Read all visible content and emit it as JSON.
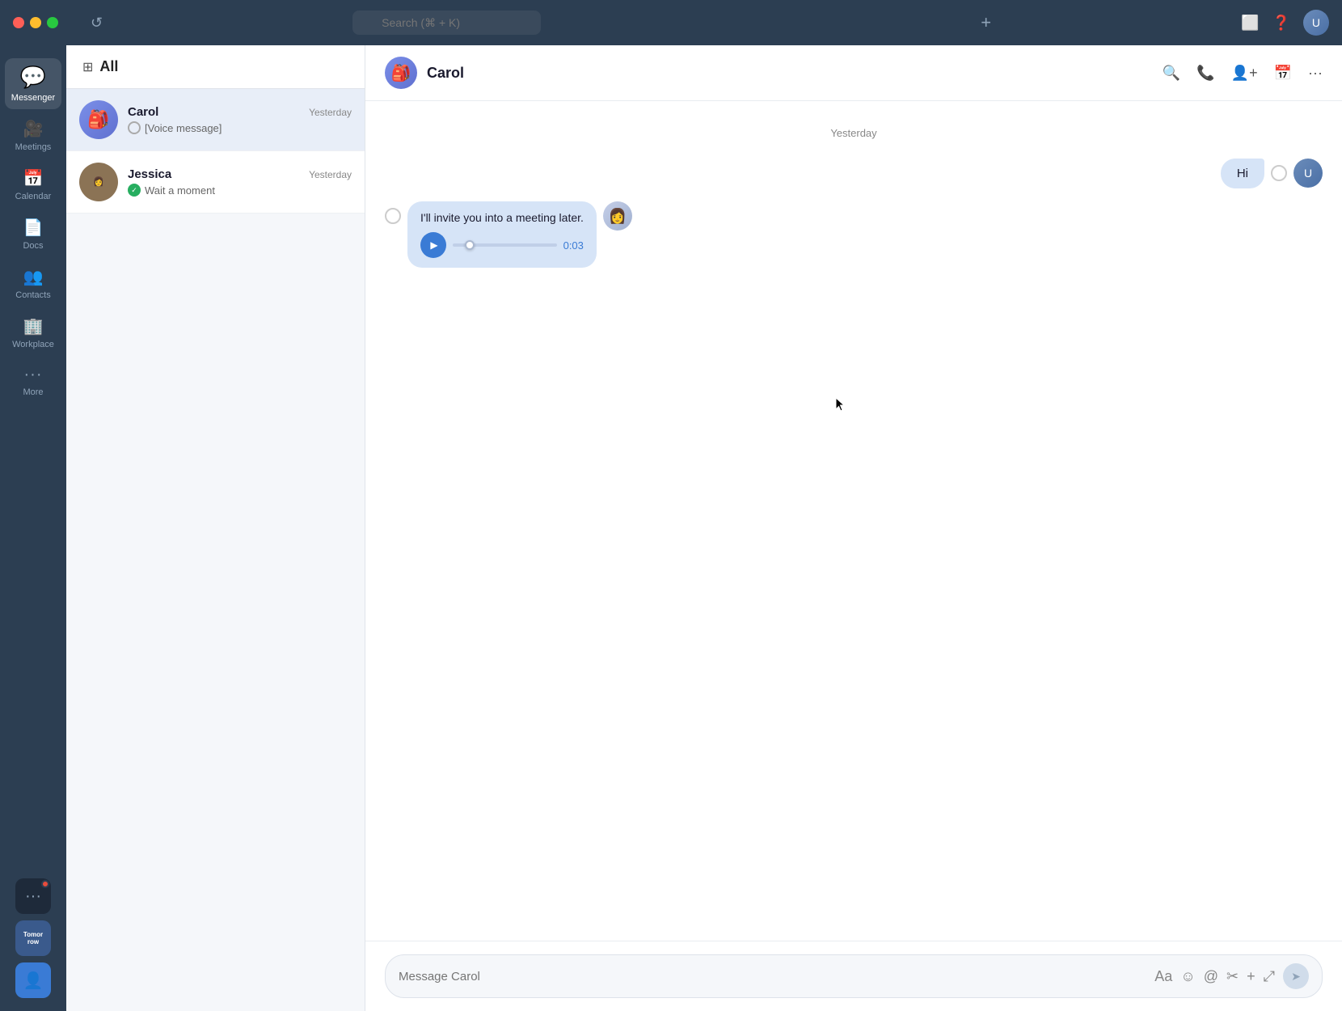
{
  "titlebar": {
    "search_placeholder": "Search (⌘ + K)",
    "add_label": "+",
    "user_initials": "U"
  },
  "sidebar": {
    "items": [
      {
        "id": "messenger",
        "label": "Messenger",
        "icon": "💬",
        "active": true
      },
      {
        "id": "meetings",
        "label": "Meetings",
        "icon": "🎥"
      },
      {
        "id": "calendar",
        "label": "Calendar",
        "icon": "📅"
      },
      {
        "id": "docs",
        "label": "Docs",
        "icon": "📄"
      },
      {
        "id": "contacts",
        "label": "Contacts",
        "icon": "👥"
      },
      {
        "id": "workplace",
        "label": "Workplace",
        "icon": "🏢"
      },
      {
        "id": "more",
        "label": "More",
        "icon": "···"
      }
    ]
  },
  "conv_list": {
    "header": "All",
    "conversations": [
      {
        "id": "carol",
        "name": "Carol",
        "time": "Yesterday",
        "preview": "[Voice message]",
        "selected": true,
        "avatar_type": "purple"
      },
      {
        "id": "jessica",
        "name": "Jessica",
        "time": "Yesterday",
        "preview": "Wait a moment",
        "selected": false,
        "avatar_type": "photo"
      }
    ]
  },
  "chat": {
    "contact_name": "Carol",
    "date_label": "Yesterday",
    "messages": [
      {
        "id": "msg1",
        "type": "text",
        "direction": "outgoing",
        "text": "Hi",
        "has_radio": true
      },
      {
        "id": "msg2",
        "type": "voice",
        "direction": "incoming",
        "text": "I'll invite you into a meeting later.",
        "voice_time": "0:03",
        "has_radio": true
      }
    ],
    "input_placeholder": "Message Carol"
  },
  "input_icons": {
    "font_size": "Aa",
    "emoji": "☺",
    "mention": "@",
    "tools": "✂",
    "add": "+",
    "expand": "⤢",
    "send": "➤"
  }
}
